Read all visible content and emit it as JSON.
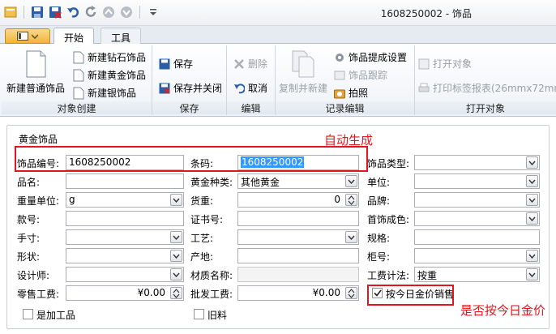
{
  "window": {
    "title": "1608250002 - 饰品"
  },
  "tabs": [
    {
      "label": "开始"
    },
    {
      "label": "工具"
    }
  ],
  "ribbon": {
    "groups": {
      "create": {
        "label": "对象创建",
        "new_normal": "新建普通饰品",
        "new_diamond": "新建钻石饰品",
        "new_gold": "新建黄金饰品",
        "new_silver": "新建银饰品"
      },
      "save": {
        "label": "保存",
        "save": "保存",
        "save_close": "保存并关闭"
      },
      "edit": {
        "label": "编辑",
        "delete": "删除",
        "cancel": "取消"
      },
      "record": {
        "label": "记录编辑",
        "copy_new": "复制并新建",
        "settings": "饰品提成设置",
        "track": "饰品跟踪",
        "photo": "拍照"
      },
      "open": {
        "label": "打开对象",
        "open_obj": "打开对象",
        "print_label": "打印标签报表(26mmx72mm"
      }
    }
  },
  "form": {
    "section_title": "黄金饰品",
    "fields": {
      "item_no": {
        "label": "饰品编号:",
        "value": "1608250002"
      },
      "barcode": {
        "label": "条码:",
        "value": "1608250002"
      },
      "item_type": {
        "label": "饰品类型:",
        "value": ""
      },
      "name": {
        "label": "品名:",
        "value": ""
      },
      "gold_type": {
        "label": "黄金种类:",
        "value": "其他黄金"
      },
      "unit": {
        "label": "单位:",
        "value": ""
      },
      "weight_unit": {
        "label": "重量单位:",
        "value": "g"
      },
      "stock_weight": {
        "label": "货重:",
        "value": "0"
      },
      "brand": {
        "label": "品牌:",
        "value": ""
      },
      "style_no": {
        "label": "款号:",
        "value": ""
      },
      "cert_no": {
        "label": "证书号:",
        "value": ""
      },
      "purity": {
        "label": "首饰成色:",
        "value": ""
      },
      "hand_size": {
        "label": "手寸:",
        "value": ""
      },
      "craft": {
        "label": "工艺:",
        "value": ""
      },
      "spec": {
        "label": "规格:",
        "value": ""
      },
      "shape": {
        "label": "形状:",
        "value": ""
      },
      "origin": {
        "label": "产地:",
        "value": ""
      },
      "counter_no": {
        "label": "柜号:",
        "value": ""
      },
      "designer": {
        "label": "设计师:",
        "value": ""
      },
      "material_name": {
        "label": "材质名称:",
        "value": ""
      },
      "labor_method": {
        "label": "工费计法:",
        "value": "按重"
      },
      "retail_labor": {
        "label": "零售工费:",
        "value": "¥0.00"
      },
      "wholesale_labor": {
        "label": "批发工费:",
        "value": "¥0.00"
      }
    },
    "checkboxes": {
      "gold_price": {
        "label": "按今日金价销售",
        "checked": true
      },
      "processed": {
        "label": "是加工品",
        "checked": false
      },
      "old_material": {
        "label": "旧料",
        "checked": false
      }
    }
  },
  "annotations": {
    "auto_generate": "自动生成",
    "gold_price_note": "是否按今日金价"
  }
}
